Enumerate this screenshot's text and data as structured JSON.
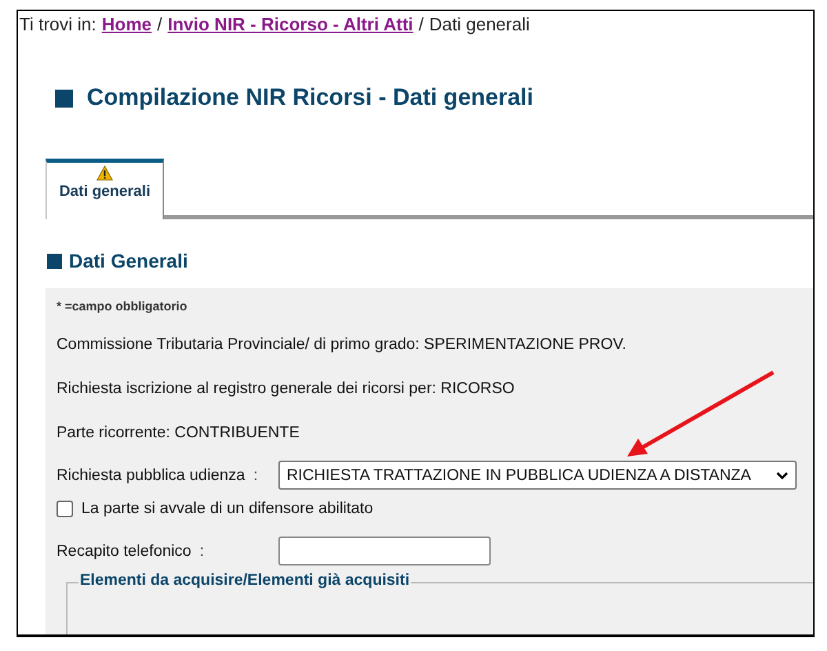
{
  "breadcrumb": {
    "prefix": "Ti trovi in:",
    "items": [
      {
        "label": "Home",
        "kind": "link"
      },
      {
        "label": "Invio NIR - Ricorso - Altri Atti",
        "kind": "link"
      },
      {
        "label": "Dati generali",
        "kind": "current"
      }
    ],
    "separator": "/"
  },
  "page_title": "Compilazione NIR Ricorsi - Dati generali",
  "tabs": [
    {
      "label": "Dati generali",
      "selected": true,
      "warning": true
    }
  ],
  "section_title": "Dati Generali",
  "required_note": "* =campo obbligatorio",
  "info_lines": [
    "Commissione Tributaria Provinciale/ di primo grado: SPERIMENTAZIONE PROV.",
    "Richiesta iscrizione al registro generale dei ricorsi per: RICORSO",
    "Parte ricorrente: CONTRIBUENTE"
  ],
  "hearing": {
    "label": "Richiesta pubblica udienza",
    "colon": ":",
    "value": "RICHIESTA TRATTAZIONE IN PUBBLICA UDIENZA A DISTANZA"
  },
  "defender": {
    "label": "La parte si avvale di un difensore abilitato",
    "checked": false
  },
  "phone": {
    "label": "Recapito telefonico",
    "colon": ":"
  },
  "fieldset_legend": "Elementi da acquisire/Elementi già acquisiti"
}
